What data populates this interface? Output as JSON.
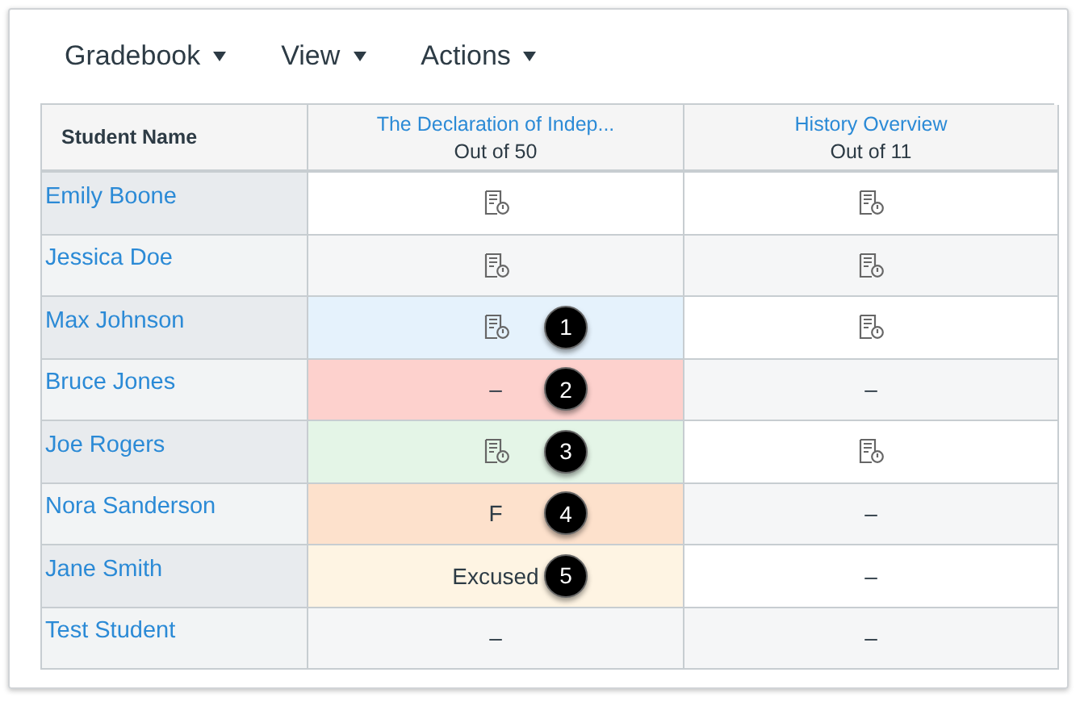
{
  "menu": [
    {
      "label": "Gradebook"
    },
    {
      "label": "View"
    },
    {
      "label": "Actions"
    }
  ],
  "table": {
    "columns": [
      {
        "title": "Student Name"
      },
      {
        "title": "The Declaration of Indep...",
        "subtitle": "Out of 50"
      },
      {
        "title": "History Overview",
        "subtitle": "Out of 11"
      }
    ],
    "rows": [
      {
        "cells": [
          {
            "kind": "name",
            "text": "Emily Boone"
          },
          {
            "kind": "icon"
          },
          {
            "kind": "icon"
          }
        ]
      },
      {
        "cells": [
          {
            "kind": "name",
            "text": "Jessica Doe"
          },
          {
            "kind": "icon"
          },
          {
            "kind": "icon"
          }
        ]
      },
      {
        "cells": [
          {
            "kind": "name",
            "text": "Max Johnson"
          },
          {
            "kind": "icon",
            "color": "#e5f2fc",
            "callout": "1"
          },
          {
            "kind": "icon"
          }
        ]
      },
      {
        "cells": [
          {
            "kind": "name",
            "text": "Bruce Jones"
          },
          {
            "kind": "text",
            "text": "–",
            "color": "#fdd1cd",
            "callout": "2"
          },
          {
            "kind": "text",
            "text": "–"
          }
        ]
      },
      {
        "cells": [
          {
            "kind": "name",
            "text": "Joe Rogers"
          },
          {
            "kind": "icon",
            "color": "#e4f5e7",
            "callout": "3"
          },
          {
            "kind": "icon"
          }
        ]
      },
      {
        "cells": [
          {
            "kind": "name",
            "text": "Nora Sanderson"
          },
          {
            "kind": "text",
            "text": "F",
            "color": "#fde1cc",
            "callout": "4"
          },
          {
            "kind": "text",
            "text": "–"
          }
        ]
      },
      {
        "cells": [
          {
            "kind": "name",
            "text": "Jane Smith"
          },
          {
            "kind": "text",
            "text": "Excused",
            "color": "#fef4e3",
            "callout": "5"
          },
          {
            "kind": "text",
            "text": "–"
          }
        ]
      },
      {
        "cells": [
          {
            "kind": "name",
            "text": "Test Student"
          },
          {
            "kind": "text",
            "text": "–"
          },
          {
            "kind": "text",
            "text": "–"
          }
        ]
      }
    ]
  }
}
